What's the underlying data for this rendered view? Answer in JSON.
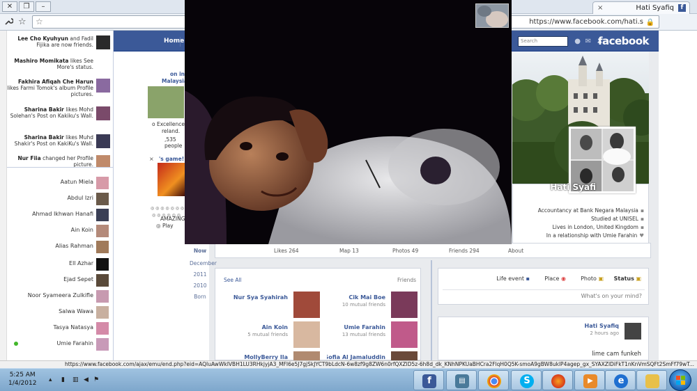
{
  "browser": {
    "tab_title": "Hati Syafiq",
    "tab_close": "×",
    "tab_favicon": "f",
    "url": "https://www.facebook.com/hati.s",
    "star_icon": "star-icon",
    "wrench_icon": "wrench-icon",
    "window_controls": [
      "✕",
      "❐",
      "–"
    ]
  },
  "facebook": {
    "logo": "facebook",
    "search_placeholder": "Search",
    "home_label": "Home"
  },
  "ticker": [
    {
      "name": "Lee Cho Kyuhyun",
      "text": "and Fadil Fijika are now friends."
    },
    {
      "name": "Mashiro Momikata",
      "text": "likes See More's status."
    },
    {
      "name": "Fakhira Afiqah Che Harun",
      "text": "likes Farmi Tomok's album Profile pictures."
    },
    {
      "name": "Sharina Bakir",
      "text": "likes Mohd Solehan's Post on Kakiku's Wall."
    },
    {
      "name": "Sharina Bakir",
      "text": "likes Muhd Shakir's Post on KakiKu's Wall."
    },
    {
      "name": "Nur Fiia",
      "text": "changed her Profile picture."
    }
  ],
  "chat": [
    "Aatun Miela",
    "Abdul Izri",
    "Ahmad Ikhwan Hanafi",
    "Ain Koin",
    "Alias Rahman",
    "Ell Azhar",
    "Ejad Sepet",
    "Noor Syameera Zulkifle",
    "Salwa Wawa",
    "Tasya Natasya",
    "Umie Farahin"
  ],
  "ads": {
    "line1": "on in",
    "line2": "Malaysia",
    "line3": "o Excellence.",
    "line4": "reland.",
    "line5": ",535 people",
    "line6": "'s game!",
    "line7": "AMAZING",
    "line8": "Play"
  },
  "profile": {
    "name": "Hati Syafi",
    "info": [
      "Accountancy at Bank Negara Malaysia",
      "Studied at UNISEL",
      "Lives in London, United Kingdom",
      "In a relationship with Umie Farahin"
    ],
    "nav": [
      "About",
      "Friends 294",
      "Photos 49",
      "Map 13",
      "Likes 264"
    ]
  },
  "timeline": {
    "items": [
      "Now",
      "December",
      "2011",
      "2010",
      "Born"
    ]
  },
  "friends": {
    "title": "Friends",
    "see_all": "See All",
    "items": [
      {
        "name": "Cik Mai Boe",
        "mutual": "10 mutual friends"
      },
      {
        "name": "Nur Sya Syahirah",
        "mutual": ""
      },
      {
        "name": "Umie Farahin",
        "mutual": "13 mutual friends"
      },
      {
        "name": "Ain Koin",
        "mutual": "5 mutual friends"
      },
      {
        "name": "Sofia Al Jamaluddin",
        "mutual": ""
      },
      {
        "name": "MollyBerry Ila",
        "mutual": ""
      }
    ]
  },
  "composer": {
    "tabs": [
      "Status",
      "Photo",
      "Place",
      "Life event"
    ],
    "placeholder": "What's on your mind?"
  },
  "post": {
    "name": "Hati Syafiq",
    "time": "2 hours ago",
    "text": "lime cam funkeh"
  },
  "statusbar": {
    "url": "https://www.facebook.com/ajax/emu/end.php?eid=AQIuAwWkIVBH1LU3RHkjyjA3_MFI6e5J7gjSkJYCT9bLdcN-6w8zf9g8ZW6n0rfQXZlD5z-6h8d_dk_KNhNPKUaBHCra2FlqH0Q5K-smoA9gBW8uklP4agep_gx_SYAXZlDiFkT1nKnVmSQFt2SmFf79wT..."
  },
  "taskbar": {
    "time": "5:25 AM",
    "date": "1/4/2012"
  }
}
